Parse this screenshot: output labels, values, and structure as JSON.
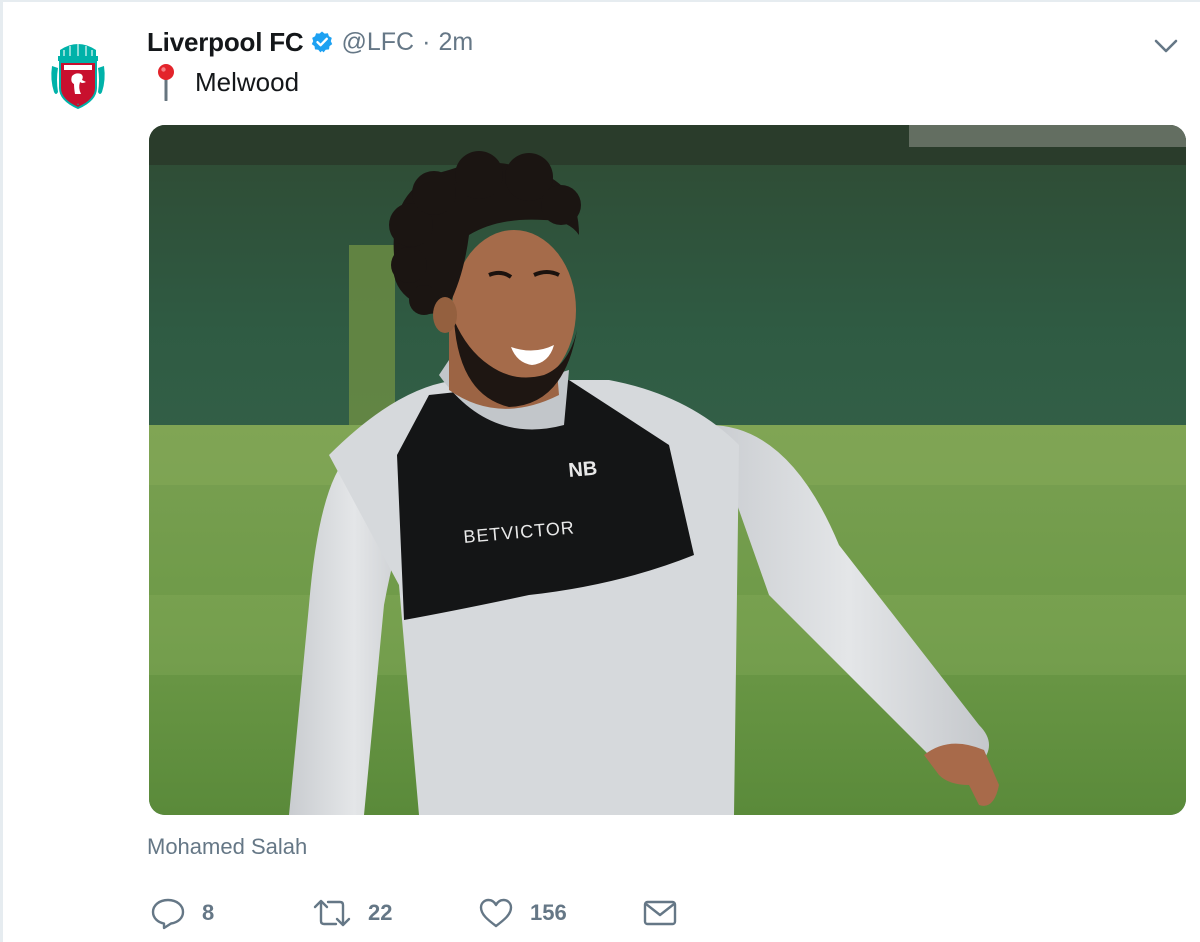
{
  "tweet": {
    "author_name": "Liverpool FC",
    "handle": "@LFC",
    "separator": "·",
    "time": "2m",
    "location_emoji": "round-pushpin",
    "location": "Melwood",
    "tagged": "Mohamed Salah"
  },
  "photo": {
    "shirt_sponsor": "BETVICTOR",
    "kit_brand": "NB"
  },
  "actions": {
    "replies": "8",
    "retweets": "22",
    "likes": "156"
  },
  "icons": {
    "verified": "verified-badge-icon",
    "caret": "chevron-down-icon",
    "reply": "reply-icon",
    "retweet": "retweet-icon",
    "like": "heart-icon",
    "dm": "envelope-icon"
  },
  "colors": {
    "verified_blue": "#1da1f2",
    "text_primary": "#14171a",
    "text_secondary": "#657786",
    "lfc_red": "#c8102e",
    "lfc_teal": "#00b2a9"
  }
}
